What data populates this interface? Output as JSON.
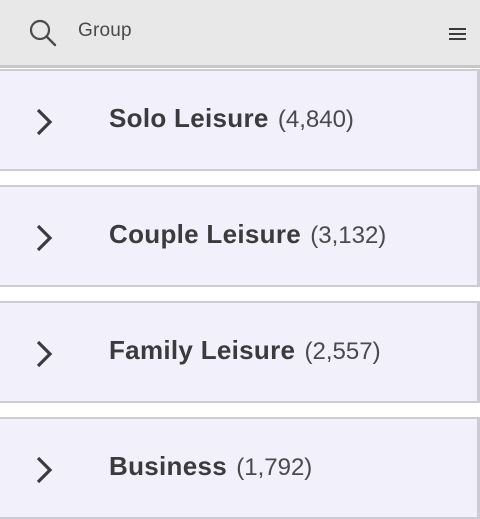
{
  "header": {
    "search_label": "Group",
    "search_icon": "search-icon",
    "menu_icon": "hamburger-menu-icon"
  },
  "groups": [
    {
      "name": "Solo Leisure",
      "count": "(4,840)"
    },
    {
      "name": "Couple Leisure",
      "count": "(3,132)"
    },
    {
      "name": "Family Leisure",
      "count": "(2,557)"
    },
    {
      "name": "Business",
      "count": "(1,792)"
    }
  ],
  "colors": {
    "header_bg": "#e8e8e8",
    "row_bg": "#f1f0fb",
    "divider": "#cdccd6",
    "text": "#3b3b3e"
  }
}
